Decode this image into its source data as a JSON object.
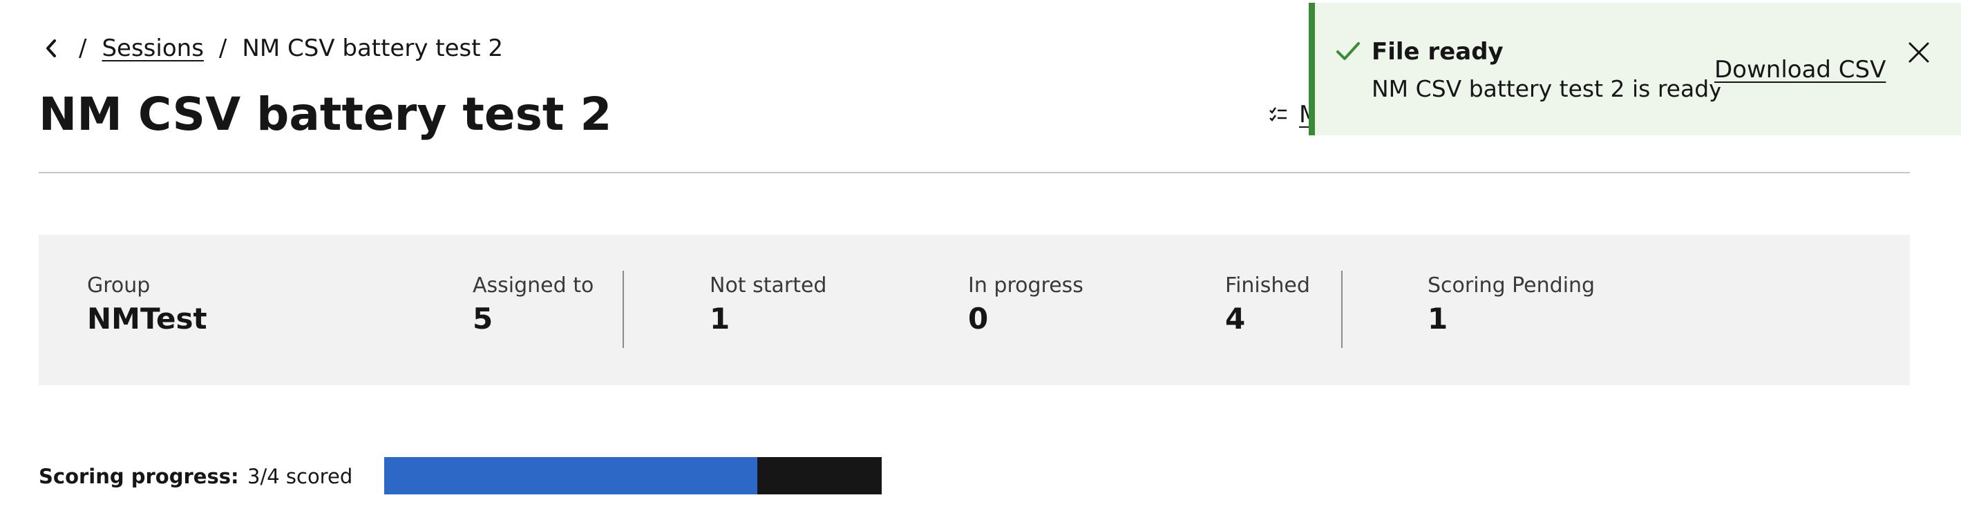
{
  "breadcrumb": {
    "back_icon": "chevron-left-icon",
    "separator": "/",
    "parent_label": "Sessions",
    "current_label": "NM CSV battery test 2"
  },
  "page": {
    "title": "NM CSV battery test 2"
  },
  "header_action": {
    "icon": "checklist-icon",
    "label_visible": "M"
  },
  "summary": {
    "stats": [
      {
        "label": "Group",
        "value": "NMTest"
      },
      {
        "label": "Assigned to",
        "value": "5"
      },
      {
        "label": "Not started",
        "value": "1"
      },
      {
        "label": "In progress",
        "value": "0"
      },
      {
        "label": "Finished",
        "value": "4"
      },
      {
        "label": "Scoring Pending",
        "value": "1"
      }
    ]
  },
  "scoring": {
    "label": "Scoring progress:",
    "text": "3/4 scored",
    "fraction": 0.75,
    "fill_color": "#2d68c7",
    "track_color": "#161616"
  },
  "toast": {
    "icon": "checkmark-icon",
    "title": "File ready",
    "message": "NM CSV battery test 2 is ready",
    "action_label": "Download CSV",
    "close_icon": "close-icon",
    "accent_color": "#3a8a37",
    "background_color": "#eef5ea"
  }
}
